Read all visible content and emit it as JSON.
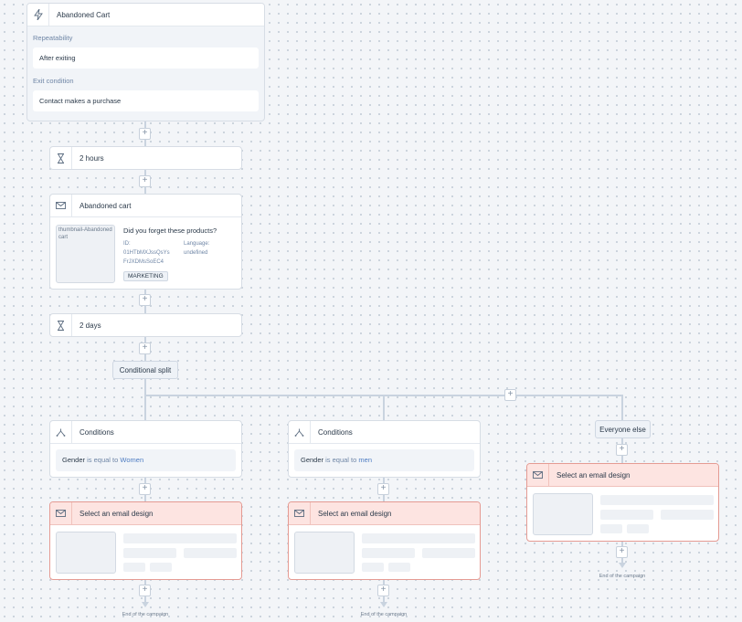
{
  "trigger": {
    "title": "Abandoned Cart",
    "icon": "lightning-icon",
    "repeatability_label": "Repeatability",
    "repeatability_value": "After exiting",
    "exit_label": "Exit condition",
    "exit_value": "Contact makes a purchase"
  },
  "delay1": {
    "label": "2 hours",
    "icon": "hourglass-icon"
  },
  "email": {
    "header": "Abandoned cart",
    "icon": "envelope-icon",
    "thumbnail_alt": "thumbnail-Abandoned cart",
    "subject": "Did you forget these products?",
    "id_label": "ID:",
    "id_value_1": "01HTbMXJssQsYs",
    "id_value_2": "FrJXDMsSoEC4",
    "language_label": "Language:",
    "language_value": "undefined",
    "tag": "MARKETING"
  },
  "delay2": {
    "label": "2 days",
    "icon": "hourglass-icon"
  },
  "split": {
    "label": "Conditional split"
  },
  "branches": [
    {
      "header": "Conditions",
      "field": "Gender",
      "operator": "is equal to",
      "value": "Women",
      "design_label": "Select an email design",
      "end_label": "End of the campaign"
    },
    {
      "header": "Conditions",
      "field": "Gender",
      "operator": "is equal to",
      "value": "men",
      "design_label": "Select an email design",
      "end_label": "End of the campaign"
    },
    {
      "header": "Everyone else",
      "design_label": "Select an email design",
      "end_label": "End of the campaign"
    }
  ],
  "plus_symbol": "+",
  "colors": {
    "accent": "#4d7cc2",
    "design_bg": "#fde4e1",
    "design_border": "#e59b93",
    "connector": "#c9d3df"
  }
}
